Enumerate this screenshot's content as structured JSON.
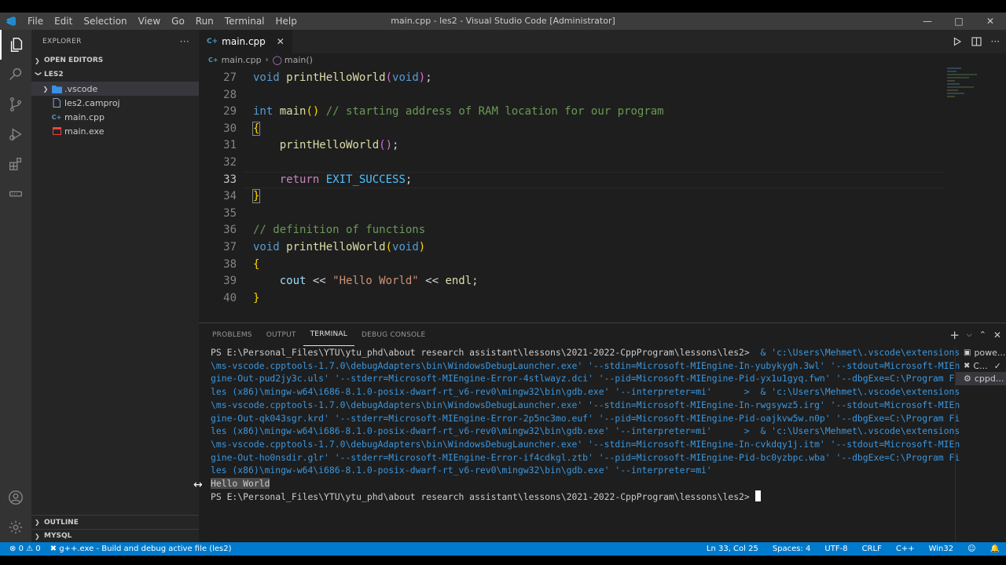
{
  "window": {
    "title": "main.cpp - les2 - Visual Studio Code [Administrator]",
    "menu": [
      "File",
      "Edit",
      "Selection",
      "View",
      "Go",
      "Run",
      "Terminal",
      "Help"
    ]
  },
  "sidebar": {
    "header": "EXPLORER",
    "open_editors": "OPEN EDITORS",
    "folder": "LES2",
    "items": [
      {
        "label": ".vscode",
        "type": "folder"
      },
      {
        "label": "les2.camproj",
        "type": "file"
      },
      {
        "label": "main.cpp",
        "type": "cpp"
      },
      {
        "label": "main.exe",
        "type": "exe"
      }
    ],
    "outline": "OUTLINE",
    "mysql": "MYSQL"
  },
  "editor": {
    "tab_label": "main.cpp",
    "tab_icon": "C+",
    "breadcrumb": {
      "file": "main.cpp",
      "symbol": "main()"
    },
    "lines": [
      {
        "n": "27"
      },
      {
        "n": "28"
      },
      {
        "n": "29"
      },
      {
        "n": "30"
      },
      {
        "n": "31"
      },
      {
        "n": "32"
      },
      {
        "n": "33"
      },
      {
        "n": "34"
      },
      {
        "n": "35"
      },
      {
        "n": "36"
      },
      {
        "n": "37"
      },
      {
        "n": "38"
      },
      {
        "n": "39"
      },
      {
        "n": "40"
      }
    ],
    "tokens": {
      "void": "void",
      "int": "int",
      "return": "return",
      "printHelloWorld": "printHelloWorld",
      "main": "main",
      "cout": "cout",
      "endl": "endl",
      "exit_success": "EXIT_SUCCESS",
      "comment_main": "// starting address of RAM location for our program",
      "comment_def": "// definition of functions",
      "hello_str": "\"Hello World\""
    }
  },
  "panel": {
    "tabs": [
      "PROBLEMS",
      "OUTPUT",
      "TERMINAL",
      "DEBUG CONSOLE"
    ],
    "active_tab": "TERMINAL",
    "terminal": {
      "prompt": "PS E:\\Personal_Files\\YTU\\ytu_phd\\about research assistant\\lessons\\2021-2022-CppProgram\\lessons\\les2> ",
      "cmd_lines": [
        "& 'c:\\Users\\Mehmet\\.vscode\\extensions",
        "\\ms-vscode.cpptools-1.7.0\\debugAdapters\\bin\\WindowsDebugLauncher.exe' '--stdin=Microsoft-MIEngine-In-yubykygh.3wl' '--stdout=Microsoft-MIEn",
        "gine-Out-pud2jy3c.uls' '--stderr=Microsoft-MIEngine-Error-4stlwayz.dci' '--pid=Microsoft-MIEngine-Pid-yx1u1gyq.fwn' '--dbgExe=C:\\Program Fi",
        "les (x86)\\mingw-w64\\i686-8.1.0-posix-dwarf-rt_v6-rev0\\mingw32\\bin\\gdb.exe' '--interpreter=mi'      >  & 'c:\\Users\\Mehmet\\.vscode\\extensions",
        "\\ms-vscode.cpptools-1.7.0\\debugAdapters\\bin\\WindowsDebugLauncher.exe' '--stdin=Microsoft-MIEngine-In-rwgsywz5.irg' '--stdout=Microsoft-MIEn",
        "gine-Out-qk043sgr.krd' '--stderr=Microsoft-MIEngine-Error-2p5nc3mo.euf' '--pid=Microsoft-MIEngine-Pid-oajkvw5w.n0p' '--dbgExe=C:\\Program Fi",
        "les (x86)\\mingw-w64\\i686-8.1.0-posix-dwarf-rt_v6-rev0\\mingw32\\bin\\gdb.exe' '--interpreter=mi'      >  & 'c:\\Users\\Mehmet\\.vscode\\extensions",
        "\\ms-vscode.cpptools-1.7.0\\debugAdapters\\bin\\WindowsDebugLauncher.exe' '--stdin=Microsoft-MIEngine-In-cvkdqy1j.itm' '--stdout=Microsoft-MIEn",
        "gine-Out-ho0nsdir.glr' '--stderr=Microsoft-MIEngine-Error-if4cdkgl.ztb' '--pid=Microsoft-MIEngine-Pid-bc0yzbpc.wba' '--dbgExe=C:\\Program Fi",
        "les (x86)\\mingw-w64\\i686-8.1.0-posix-dwarf-rt_v6-rev0\\mingw32\\bin\\gdb.exe' '--interpreter=mi'"
      ],
      "output": "Hello World",
      "prompt2": "PS E:\\Personal_Files\\YTU\\ytu_phd\\about research assistant\\lessons\\2021-2022-CppProgram\\lessons\\les2> "
    },
    "terminal_list": [
      "powe...",
      "C...",
      "cppd..."
    ]
  },
  "statusbar": {
    "errors": "0",
    "warnings": "0",
    "task": "g++.exe - Build and debug active file (les2)",
    "position": "Ln 33, Col 25",
    "spaces": "Spaces: 4",
    "encoding": "UTF-8",
    "eol": "CRLF",
    "language": "C++",
    "platform": "Win32"
  },
  "colors": {
    "accent": "#007acc",
    "keyword": "#569cd6",
    "function": "#dcdcaa",
    "comment": "#6a9955",
    "string": "#ce9178"
  }
}
